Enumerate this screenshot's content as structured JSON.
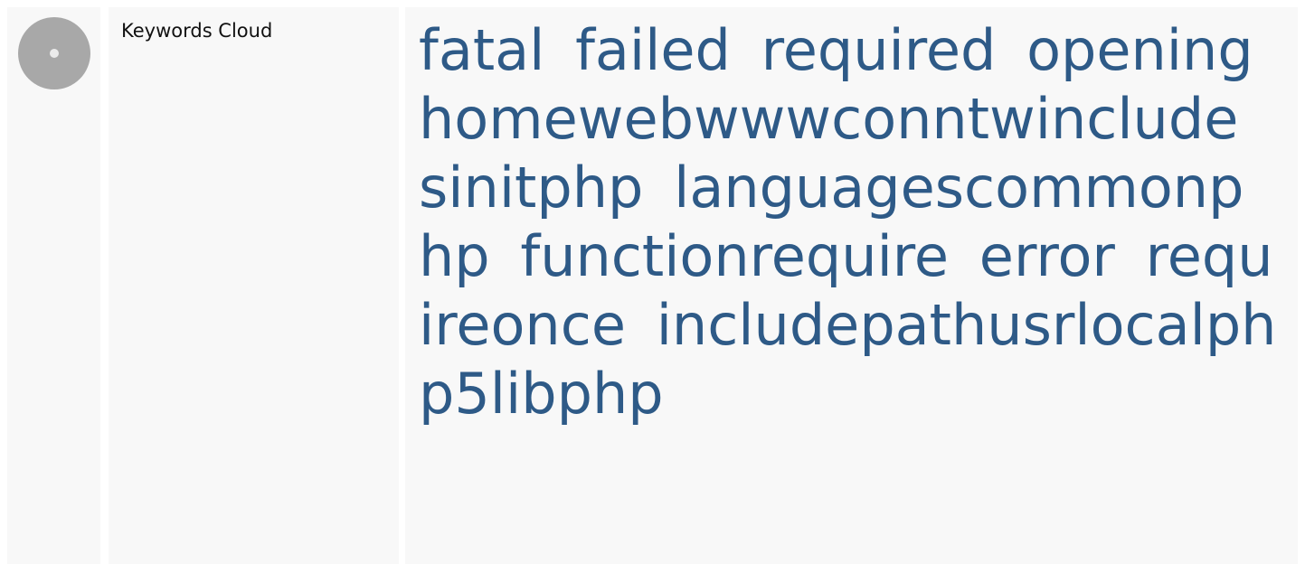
{
  "section": {
    "title": "Keywords Cloud",
    "icon": "disc-icon"
  },
  "keywords": [
    "fatal",
    "failed",
    "required",
    "opening",
    "homewebwwwconntwinclude",
    "sinitphp",
    "languagescommonphp",
    "functionrequire",
    "error",
    "requireonce",
    "includepathusrlocalphp5libphp"
  ],
  "colors": {
    "keyword": "#2e5a87",
    "panel": "#f8f8f8",
    "icon": "#a8a8a8"
  }
}
